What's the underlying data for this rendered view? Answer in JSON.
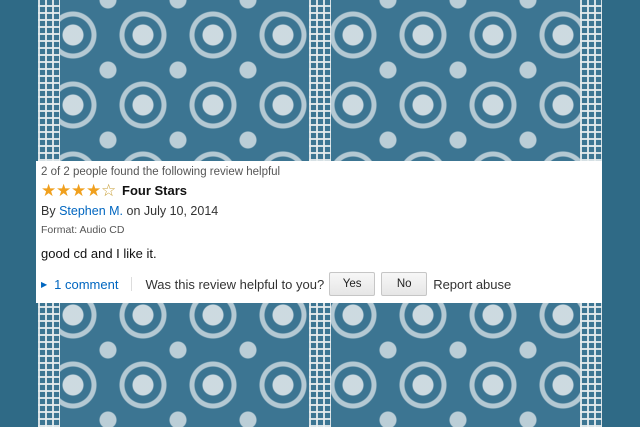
{
  "review": {
    "helpful_count": "2 of 2 people found the following review helpful",
    "rating_stars": 4,
    "max_stars": 5,
    "title": "Four Stars",
    "by_label": "By",
    "author": "Stephen M.",
    "date": "on July 10, 2014",
    "format": "Format: Audio CD",
    "body": "good cd and I like it.",
    "comments_link": "1 comment",
    "helpful_question": "Was this review helpful to you?",
    "yes_label": "Yes",
    "no_label": "No",
    "report_label": "Report abuse"
  },
  "icons": {
    "star_filled": "star-filled-icon",
    "star_empty": "star-empty-icon",
    "caret": "caret-right-icon"
  },
  "colors": {
    "background": "#2f6a86",
    "link": "#0066c0",
    "star": "#f0a01e"
  }
}
